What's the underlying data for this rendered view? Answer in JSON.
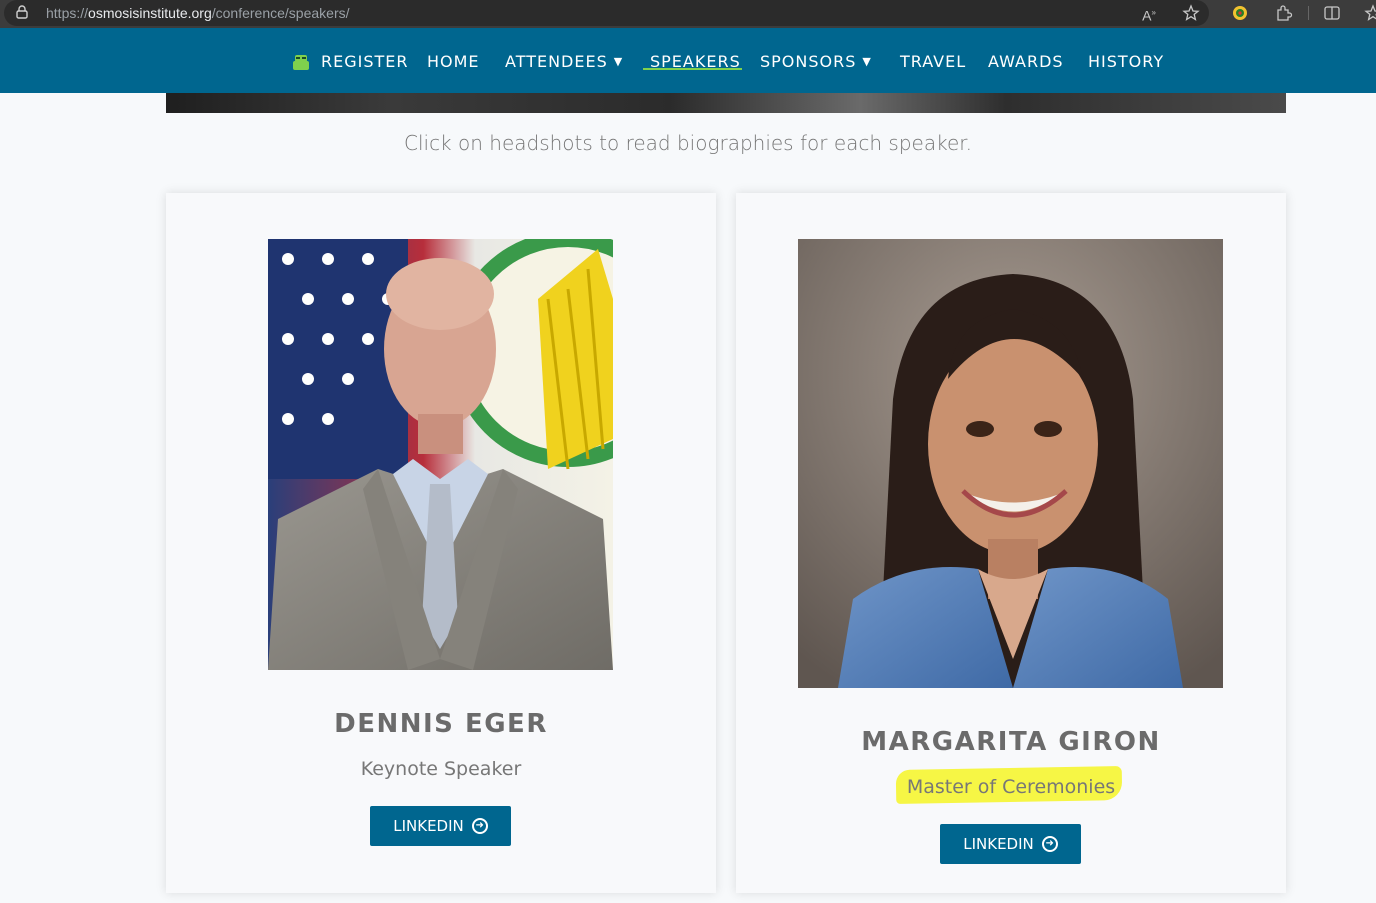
{
  "browser": {
    "url_prefix": "https://",
    "url_host": "osmosisinstitute.org",
    "url_path": "/conference/speakers/"
  },
  "nav": {
    "items": [
      {
        "label": "REGISTER"
      },
      {
        "label": "HOME"
      },
      {
        "label": "ATTENDEES"
      },
      {
        "label": "SPEAKERS"
      },
      {
        "label": "SPONSORS"
      },
      {
        "label": "TRAVEL"
      },
      {
        "label": "AWARDS"
      },
      {
        "label": "HISTORY"
      }
    ],
    "active": "SPEAKERS",
    "accent_color": "#7fd14d",
    "bar_color": "#00668f"
  },
  "intro_text": "Click on headshots to read biographies for each speaker.",
  "speakers": [
    {
      "name": "DENNIS EGER",
      "role": "Keynote Speaker",
      "button_label": "LINKEDIN"
    },
    {
      "name": "MARGARITA GIRON",
      "role": "Master of Ceremonies",
      "button_label": "LINKEDIN"
    }
  ],
  "icons": [
    "lock-icon",
    "read-aloud-icon",
    "favorite-star-icon",
    "extension-icon",
    "puzzle-icon",
    "split-screen-icon",
    "chevron-down-icon",
    "arrow-circle-right-icon",
    "register-mascot-icon"
  ],
  "colors": {
    "button": "#00668f",
    "highlight": "#f5f531"
  }
}
